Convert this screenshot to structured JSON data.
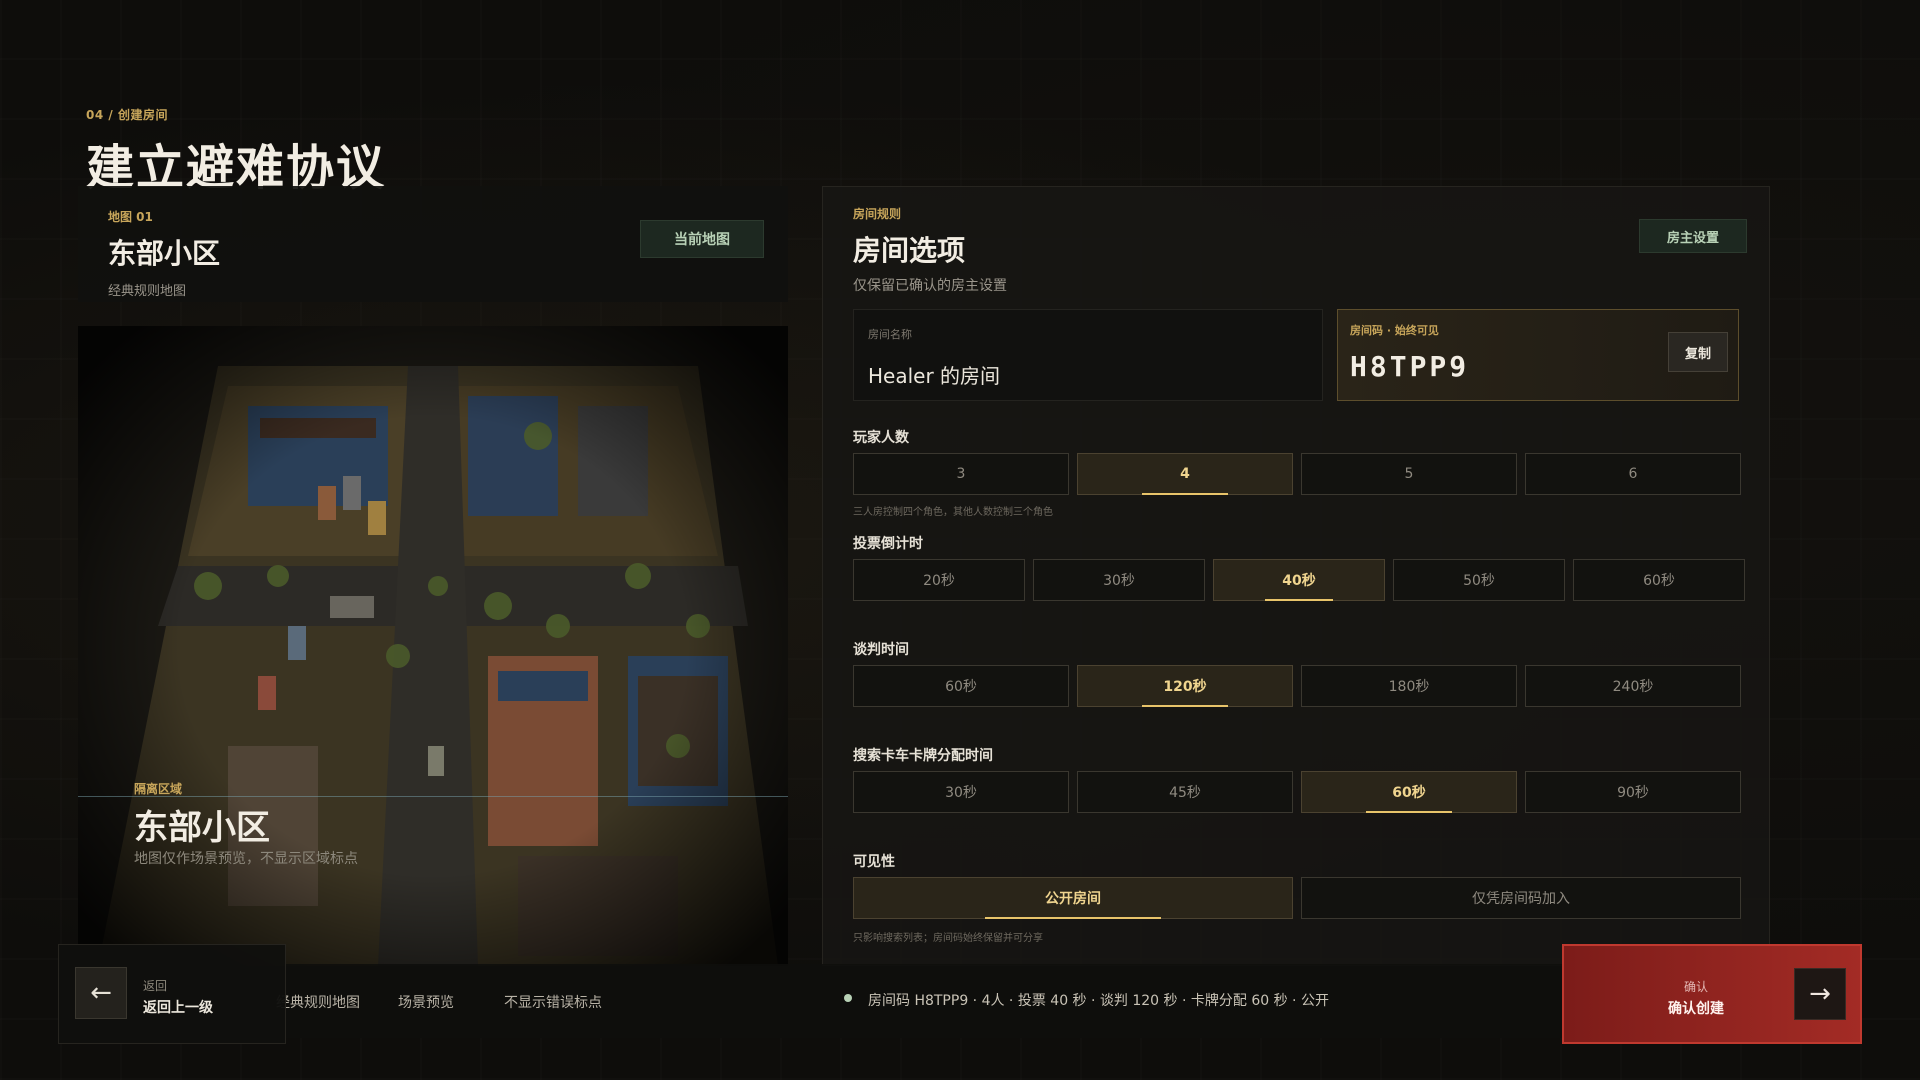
{
  "header": {
    "crumb": "04 / 创建房间",
    "title": "建立避难协议"
  },
  "map": {
    "index": "地图 01",
    "name": "东部小区",
    "subtitle": "经典规则地图",
    "current_button": "当前地图",
    "overlay_label": "隔离区域",
    "overlay_name": "东部小区",
    "overlay_desc": "地图仅作场景预览，不显示区域标点"
  },
  "room": {
    "kicker": "房间规则",
    "title": "房间选项",
    "desc": "仅保留已确认的房主设置",
    "host_button": "房主设置",
    "name_label": "房间名称",
    "name_value": "Healer 的房间",
    "code_label": "房间码 · 始终可见",
    "code_value": "H8TPP9",
    "copy_button": "复制"
  },
  "players": {
    "label": "玩家人数",
    "options": [
      "3",
      "4",
      "5",
      "6"
    ],
    "selected": "4",
    "hint": "三人房控制四个角色，其他人数控制三个角色"
  },
  "vote": {
    "label": "投票倒计时",
    "options": [
      "20秒",
      "30秒",
      "40秒",
      "50秒",
      "60秒"
    ],
    "selected": "40秒"
  },
  "negotiation": {
    "label": "谈判时间",
    "options": [
      "60秒",
      "120秒",
      "180秒",
      "240秒"
    ],
    "selected": "120秒"
  },
  "search": {
    "label": "搜索卡车卡牌分配时间",
    "options": [
      "30秒",
      "45秒",
      "60秒",
      "90秒"
    ],
    "selected": "60秒"
  },
  "visibility": {
    "label": "可见性",
    "options": [
      "公开房间",
      "仅凭房间码加入"
    ],
    "selected": "公开房间",
    "hint": "只影响搜索列表；房间码始终保留并可分享"
  },
  "bottom": {
    "back_small": "返回",
    "back_big": "返回上一级",
    "tabs": [
      "经典规则地图",
      "场景预览",
      "不显示错误标点"
    ],
    "status": "房间码 H8TPP9 · 4人 · 投票 40 秒 · 谈判 120 秒 · 卡牌分配 60 秒 · 公开",
    "confirm_small": "确认",
    "confirm_big": "确认创建"
  },
  "colors": {
    "accent": "#e8c46a",
    "confirm": "#a32b25",
    "map_tag": "#b8d1b6"
  },
  "icons": {
    "back": "arrow-left-icon",
    "confirm": "arrow-right-icon"
  }
}
